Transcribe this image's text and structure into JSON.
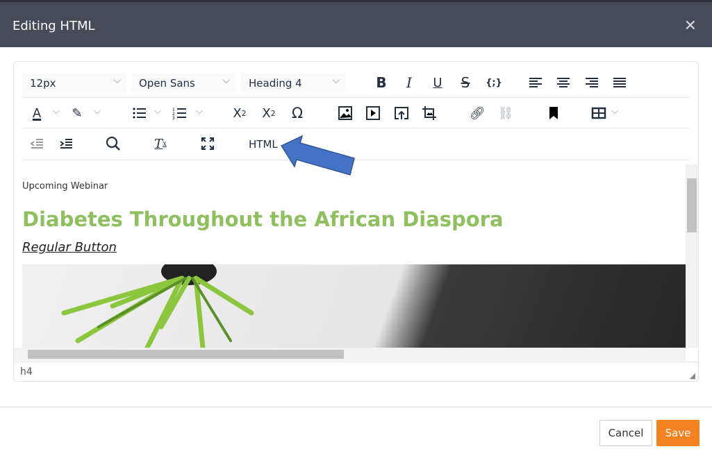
{
  "dialog": {
    "title": "Editing HTML"
  },
  "toolbar": {
    "font_size": "12px",
    "font_family": "Open Sans",
    "block_format": "Heading 4",
    "html_label": "HTML"
  },
  "content": {
    "eyebrow": "Upcoming Webinar",
    "heading": "Diabetes Throughout the African Diaspora",
    "link": "Regular Button",
    "heading_color": "#8fbf5f"
  },
  "status": {
    "path": "h4"
  },
  "footer": {
    "cancel": "Cancel",
    "save": "Save",
    "save_color": "#f58220"
  }
}
